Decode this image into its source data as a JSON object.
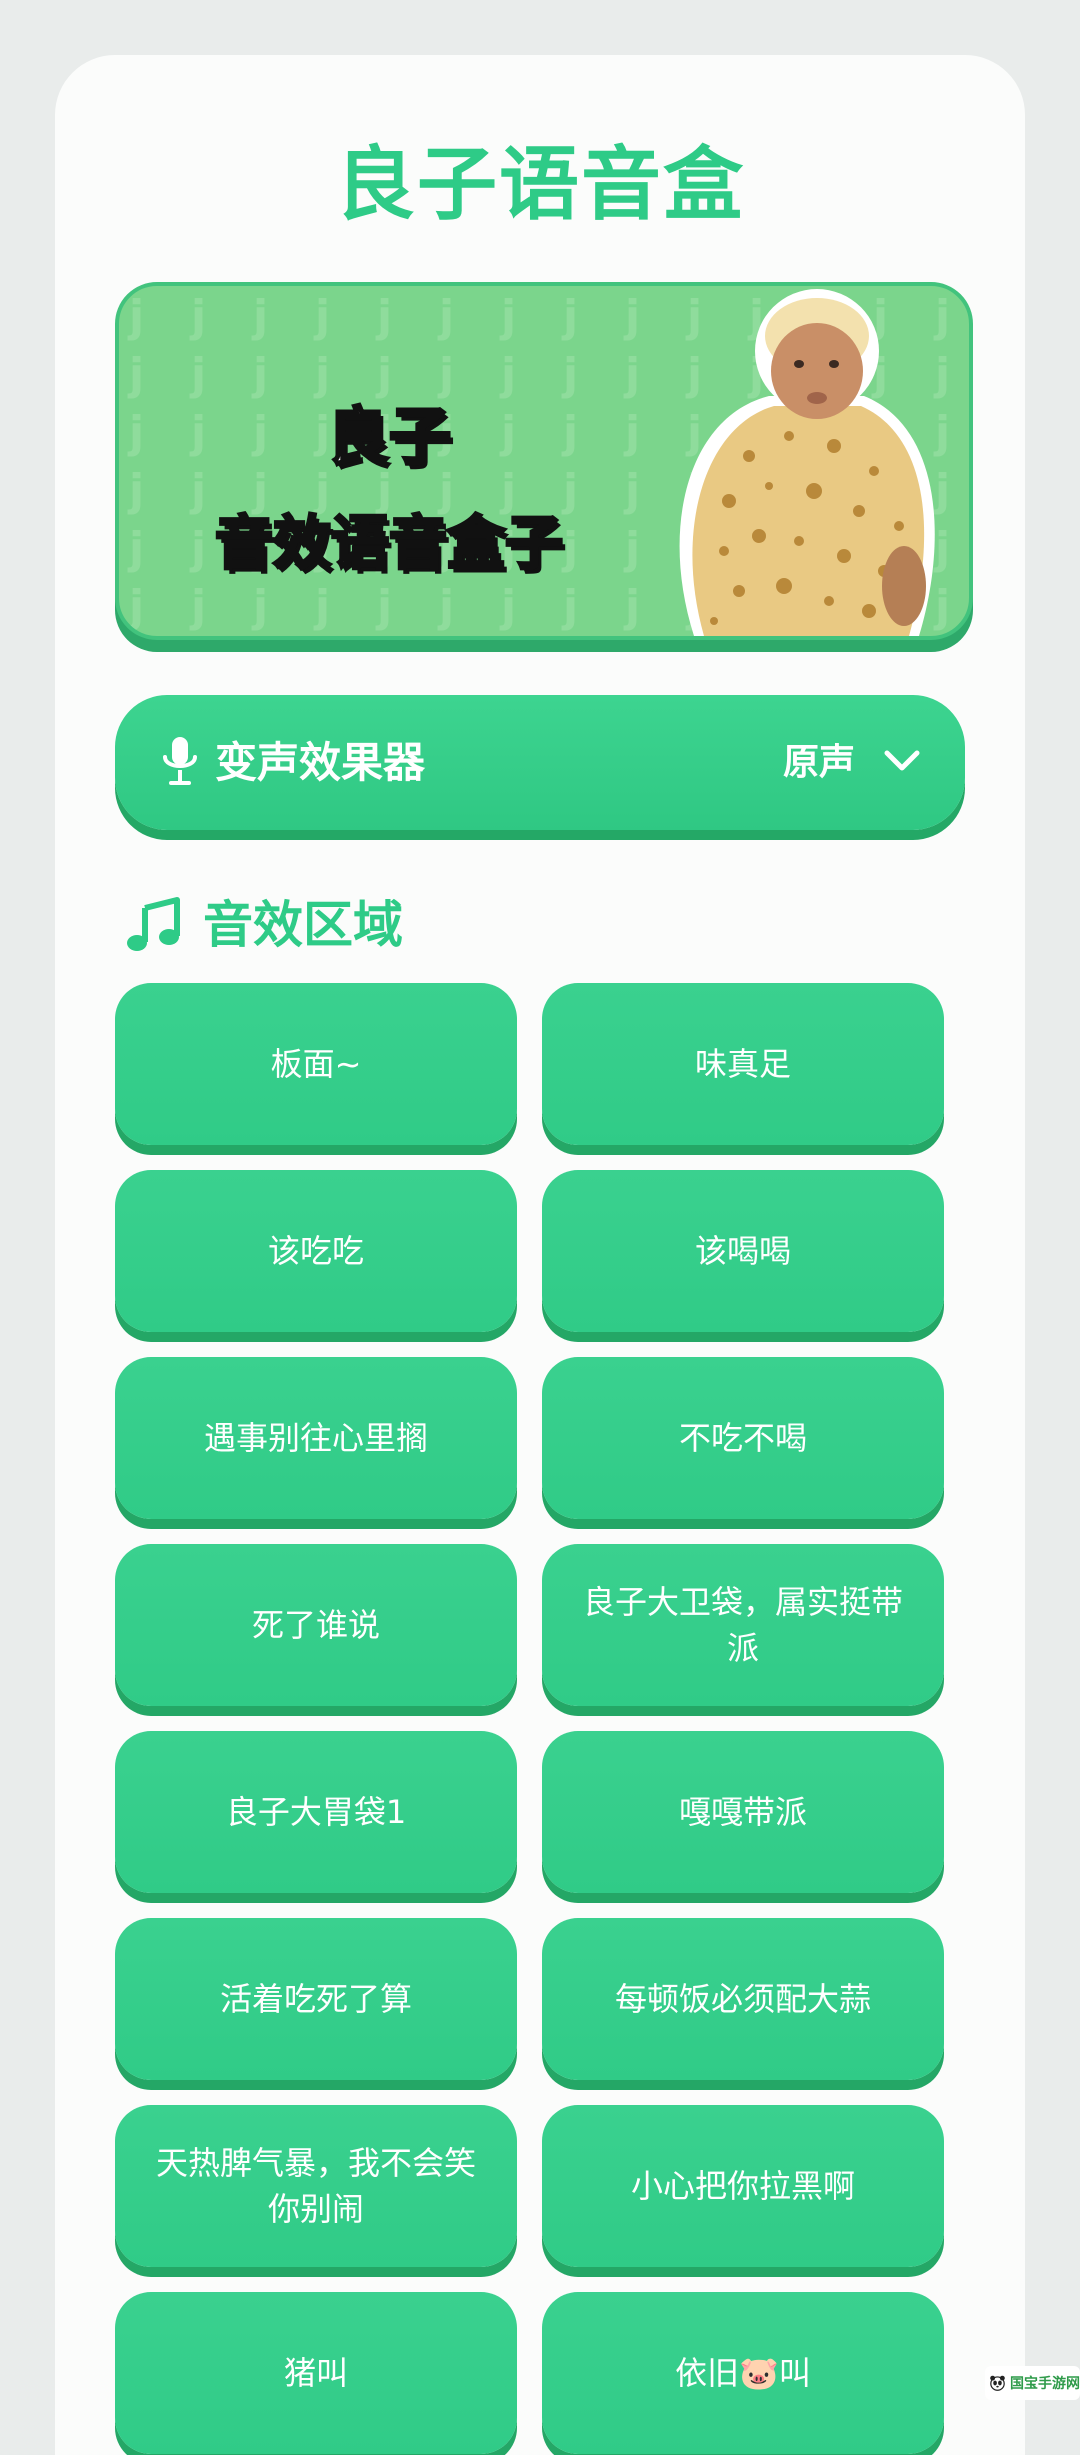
{
  "app": {
    "title": "良子语音盒"
  },
  "banner": {
    "line1": "良子",
    "line2": "音效语音盒子"
  },
  "voice_changer": {
    "label": "变声效果器",
    "value": "原声"
  },
  "sound_section": {
    "title": "音效区域",
    "buttons": [
      "板面~",
      "味真足",
      "该吃吃",
      "该喝喝",
      "遇事别往心里搁",
      "不吃不喝",
      "死了谁说",
      "良子大卫袋，属实挺带派",
      "良子大胃袋1",
      "嘎嘎带派",
      "活着吃死了算",
      "每顿饭必须配大蒜",
      "天热脾气暴，我不会笑你别闹",
      "小心把你拉黑啊",
      "猪叫",
      "依旧🐷叫"
    ]
  },
  "colors": {
    "accent": "#2ecb87",
    "button": "#34cd8a",
    "button_shadow": "#24a766",
    "banner_bg": "#7bd58c"
  }
}
